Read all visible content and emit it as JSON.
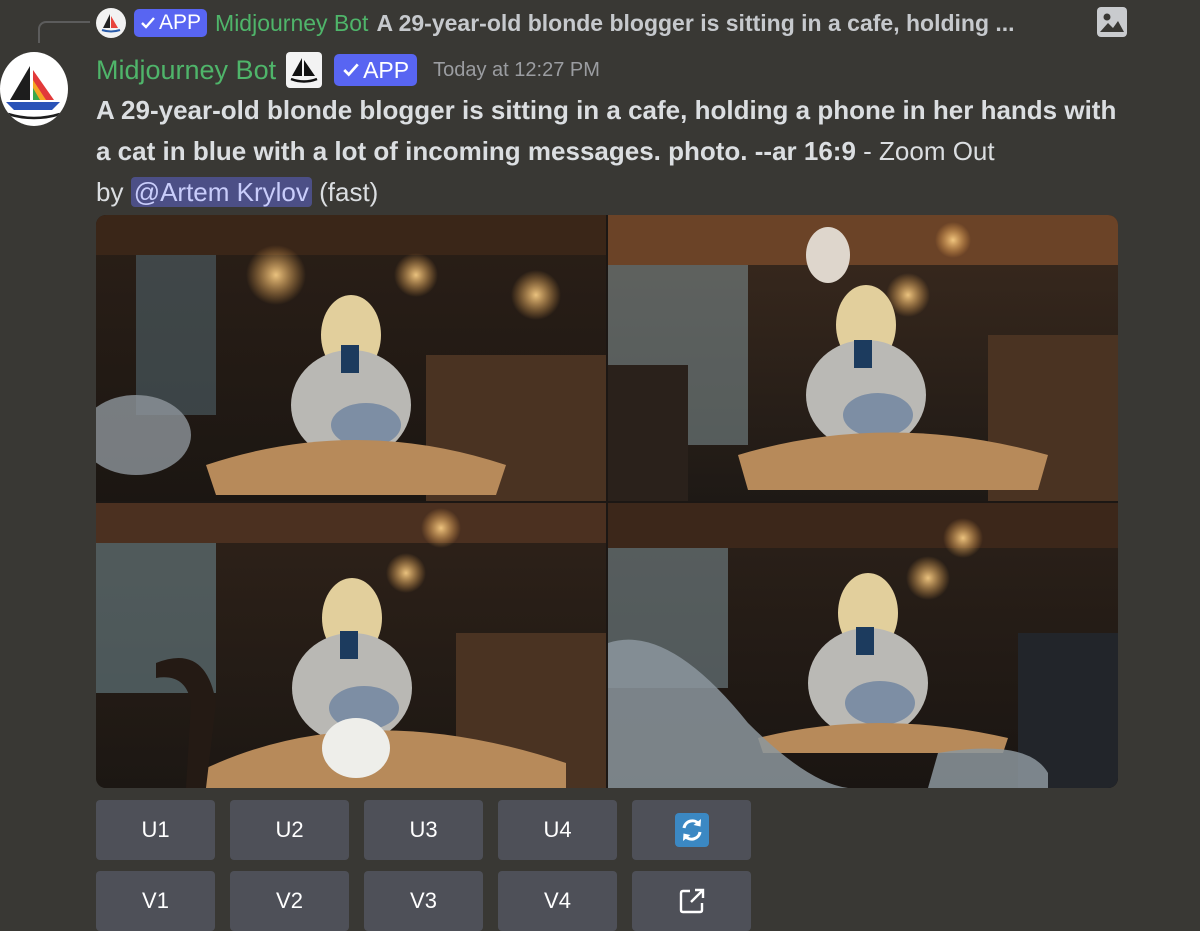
{
  "reply": {
    "app_label": "APP",
    "author": "Midjourney Bot",
    "text": "A 29-year-old blonde blogger is sitting in a cafe, holding ..."
  },
  "header": {
    "author": "Midjourney Bot",
    "app_label": "APP",
    "timestamp": "Today at 12:27 PM"
  },
  "message": {
    "prompt": "A 29-year-old blonde blogger is sitting in a cafe, holding a phone in her hands with a cat in blue with a lot of incoming messages. photo. --ar 16:9",
    "suffix": " - Zoom Out",
    "by": "by ",
    "mention": "@Artem Krylov",
    "mode": " (fast)"
  },
  "buttons": {
    "upscale": [
      "U1",
      "U2",
      "U3",
      "U4"
    ],
    "variation": [
      "V1",
      "V2",
      "V3",
      "V4"
    ]
  },
  "icons": {
    "reroll": "refresh-icon",
    "web": "external-link-icon",
    "attachment": "image-icon"
  },
  "colors": {
    "background": "#393834",
    "username": "#4fb56a",
    "app_badge": "#5865f2",
    "button": "#4e5058",
    "mention": "#4c4f86"
  }
}
